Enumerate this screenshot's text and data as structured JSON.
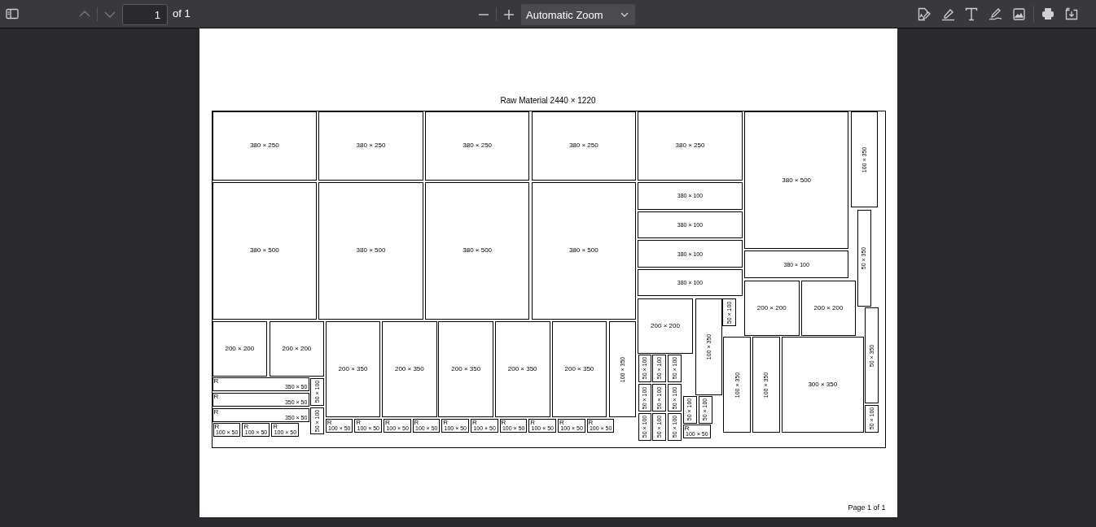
{
  "toolbar": {
    "page_number": "1",
    "page_total": "of 1",
    "zoom": "Automatic Zoom"
  },
  "document": {
    "title": "Raw Material 2440 × 1220",
    "footer": "Page 1 of 1",
    "pieces": [
      {
        "label": "380 × 250",
        "rotated": false
      },
      {
        "label": "380 × 250",
        "rotated": false
      },
      {
        "label": "380 × 250",
        "rotated": false
      },
      {
        "label": "380 × 250",
        "rotated": false
      },
      {
        "label": "380 × 250",
        "rotated": false
      },
      {
        "label": "380 × 500",
        "rotated": false
      },
      {
        "label": "380 × 500",
        "rotated": false
      },
      {
        "label": "380 × 500",
        "rotated": false
      },
      {
        "label": "380 × 500",
        "rotated": false
      },
      {
        "label": "380 × 500",
        "rotated": false
      },
      {
        "label": "100 × 350",
        "rotated": false
      },
      {
        "label": "380 × 100",
        "rotated": false
      },
      {
        "label": "380 × 100",
        "rotated": false
      },
      {
        "label": "380 × 100",
        "rotated": false
      },
      {
        "label": "380 × 100",
        "rotated": false
      },
      {
        "label": "380 × 100",
        "rotated": false
      },
      {
        "label": "50 × 350",
        "rotated": false
      },
      {
        "label": "200 × 200",
        "rotated": false
      },
      {
        "label": "200 × 200",
        "rotated": false
      },
      {
        "label": "200 × 200",
        "rotated": false
      },
      {
        "label": "100 × 350",
        "rotated": false
      },
      {
        "label": "50 × 100",
        "rotated": false
      },
      {
        "label": "100 × 350",
        "rotated": false
      },
      {
        "label": "100 × 350",
        "rotated": false
      },
      {
        "label": "300 × 350",
        "rotated": false
      },
      {
        "label": "50 × 350",
        "rotated": false
      },
      {
        "label": "50 × 100",
        "rotated": false
      },
      {
        "label": "200 × 200",
        "rotated": false
      },
      {
        "label": "200 × 200",
        "rotated": false
      },
      {
        "label": "200 × 350",
        "rotated": false
      },
      {
        "label": "200 × 350",
        "rotated": false
      },
      {
        "label": "200 × 350",
        "rotated": false
      },
      {
        "label": "200 × 350",
        "rotated": false
      },
      {
        "label": "200 × 350",
        "rotated": false
      },
      {
        "label": "100 × 350",
        "rotated": false
      },
      {
        "label": "350 × 50",
        "rotated": true,
        "mark": "R"
      },
      {
        "label": "350 × 50",
        "rotated": true,
        "mark": "R"
      },
      {
        "label": "350 × 50",
        "rotated": true,
        "mark": "R"
      },
      {
        "label": "50 × 100",
        "rotated": false
      },
      {
        "label": "50 × 100",
        "rotated": false
      },
      {
        "label": "100 × 50",
        "rotated": true,
        "mark": "R"
      },
      {
        "label": "100 × 50",
        "rotated": true,
        "mark": "R"
      },
      {
        "label": "100 × 50",
        "rotated": true,
        "mark": "R"
      },
      {
        "label": "100 × 50",
        "rotated": true,
        "mark": "R"
      },
      {
        "label": "100 × 50",
        "rotated": true,
        "mark": "R"
      },
      {
        "label": "100 × 50",
        "rotated": true,
        "mark": "R"
      },
      {
        "label": "100 × 50",
        "rotated": true,
        "mark": "R"
      },
      {
        "label": "100 × 50",
        "rotated": true,
        "mark": "R"
      },
      {
        "label": "100 × 50",
        "rotated": true,
        "mark": "R"
      },
      {
        "label": "100 × 50",
        "rotated": true,
        "mark": "R"
      },
      {
        "label": "100 × 50",
        "rotated": true,
        "mark": "R"
      },
      {
        "label": "100 × 50",
        "rotated": true,
        "mark": "R"
      },
      {
        "label": "100 × 50",
        "rotated": true,
        "mark": "R"
      },
      {
        "label": "50 × 100",
        "rotated": false
      },
      {
        "label": "50 × 100",
        "rotated": false
      },
      {
        "label": "50 × 100",
        "rotated": false
      },
      {
        "label": "50 × 100",
        "rotated": false
      },
      {
        "label": "50 × 100",
        "rotated": false
      },
      {
        "label": "50 × 100",
        "rotated": false
      },
      {
        "label": "50 × 100",
        "rotated": false
      },
      {
        "label": "50 × 100",
        "rotated": false
      },
      {
        "label": "50 × 100",
        "rotated": false
      },
      {
        "label": "50 × 100",
        "rotated": false
      },
      {
        "label": "50 × 100",
        "rotated": false
      },
      {
        "label": "100 × 50",
        "rotated": true,
        "mark": "R"
      }
    ]
  }
}
